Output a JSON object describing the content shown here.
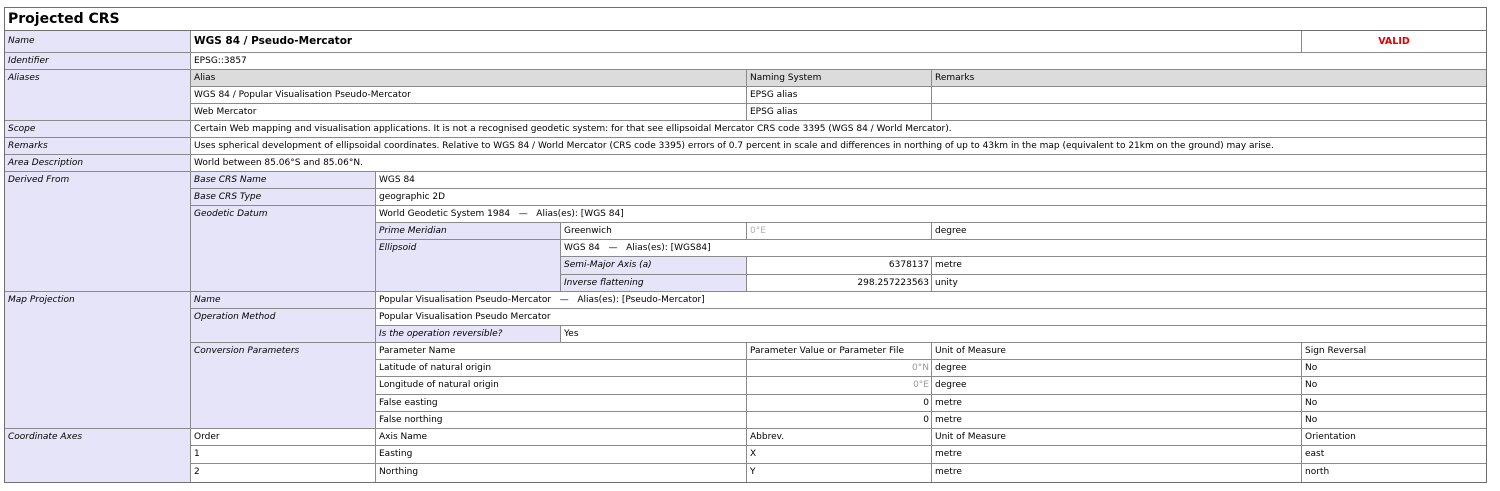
{
  "title": "Projected CRS",
  "status": "VALID",
  "labels": {
    "name": "Name",
    "identifier": "Identifier",
    "aliases": "Aliases",
    "scope": "Scope",
    "remarks": "Remarks",
    "area_description": "Area Description",
    "derived_from": "Derived From",
    "map_projection": "Map Projection",
    "coordinate_axes": "Coordinate Axes"
  },
  "name": "WGS 84 / Pseudo-Mercator",
  "identifier": "EPSG::3857",
  "aliases": {
    "headers": [
      "Alias",
      "Naming System",
      "Remarks"
    ],
    "rows": [
      [
        "WGS 84 / Popular Visualisation Pseudo-Mercator",
        "EPSG alias",
        ""
      ],
      [
        "Web Mercator",
        "EPSG alias",
        ""
      ]
    ]
  },
  "scope": "Certain Web mapping and visualisation applications. It is not a recognised geodetic system: for that see ellipsoidal Mercator CRS code 3395 (WGS 84 / World Mercator).",
  "remarks": "Uses spherical development of ellipsoidal coordinates. Relative to WGS 84 / World Mercator (CRS code 3395) errors of 0.7 percent in scale and differences in northing of up to 43km in the map (equivalent to 21km on the ground) may arise.",
  "area_description": "World between 85.06°S and 85.06°N.",
  "derived_from": {
    "base_crs_name_label": "Base CRS Name",
    "base_crs_name": "WGS 84",
    "base_crs_type_label": "Base CRS Type",
    "base_crs_type": "geographic 2D",
    "geodetic_datum_label": "Geodetic Datum",
    "geodetic_datum": "World Geodetic System 1984",
    "datum_alias_sep": "—",
    "datum_aliases": "Alias(es): [WGS 84]",
    "prime_meridian_label": "Prime Meridian",
    "prime_meridian": "Greenwich",
    "prime_meridian_value": "0°E",
    "prime_meridian_unit": "degree",
    "ellipsoid_label": "Ellipsoid",
    "ellipsoid": "WGS 84",
    "ellipsoid_alias_sep": "—",
    "ellipsoid_aliases": "Alias(es): [WGS84]",
    "semi_major_label": "Semi-Major Axis (a)",
    "semi_major_value": "6378137",
    "semi_major_unit": "metre",
    "inv_flattening_label": "Inverse flattening",
    "inv_flattening_value": "298.257223563",
    "inv_flattening_unit": "unity"
  },
  "map_projection": {
    "name_label": "Name",
    "name": "Popular Visualisation Pseudo-Mercator",
    "name_alias_sep": "—",
    "name_aliases": "Alias(es): [Pseudo-Mercator]",
    "operation_method_label": "Operation Method",
    "operation_method": "Popular Visualisation Pseudo Mercator",
    "reversible_label": "Is the operation reversible?",
    "reversible": "Yes",
    "conversion_parameters_label": "Conversion Parameters",
    "param_headers": [
      "Parameter Name",
      "Parameter Value or Parameter File",
      "Unit of Measure",
      "Sign Reversal"
    ],
    "params": [
      [
        "Latitude of natural origin",
        "0°N",
        "degree",
        "No"
      ],
      [
        "Longitude of natural origin",
        "0°E",
        "degree",
        "No"
      ],
      [
        "False easting",
        "0",
        "metre",
        "No"
      ],
      [
        "False northing",
        "0",
        "metre",
        "No"
      ]
    ]
  },
  "coordinate_axes": {
    "headers": [
      "Order",
      "Axis Name",
      "Abbrev.",
      "Unit of Measure",
      "Orientation"
    ],
    "rows": [
      [
        "1",
        "Easting",
        "X",
        "metre",
        "east"
      ],
      [
        "2",
        "Northing",
        "Y",
        "metre",
        "north"
      ]
    ]
  }
}
